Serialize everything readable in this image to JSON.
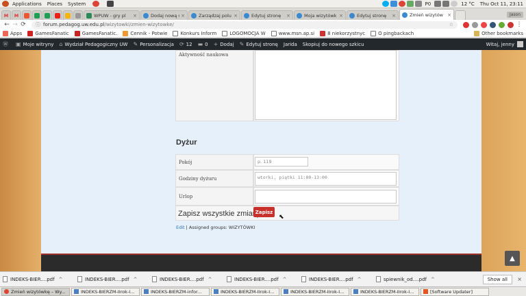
{
  "panel": {
    "applications": "Applications",
    "places": "Places",
    "system": "System",
    "indicator_p0": "P0",
    "weather": "12 °C",
    "clock": "Thu Oct 11, 23:11"
  },
  "tabs": [
    {
      "title": "WPUW - gry pl",
      "color": "#3b8ad0"
    },
    {
      "title": "Dodaj nową st",
      "color": "#3b8ad0"
    },
    {
      "title": "Zarządzaj polu",
      "color": "#3b8ad0"
    },
    {
      "title": "Edytuj stronę",
      "color": "#3b8ad0"
    },
    {
      "title": "Moja wizytówk",
      "color": "#3b8ad0"
    },
    {
      "title": "Edytuj stronę",
      "color": "#3b8ad0"
    },
    {
      "title": "Zmień wizytów",
      "color": "#3b8ad0"
    }
  ],
  "profile_label": "Jason",
  "address": {
    "host": "forum.pedagog.uw.edu.pl",
    "path": "/wizytowki/zmien-wizytowke/"
  },
  "bookmarks": [
    {
      "label": "Apps"
    },
    {
      "label": "GamesFanatic"
    },
    {
      "label": "GamesFanatic."
    },
    {
      "label": "Cennik - Potwie"
    },
    {
      "label": "Konkurs Inform"
    },
    {
      "label": "LOGOMOCJA W"
    },
    {
      "label": "www.msn.ap.si"
    },
    {
      "label": "8 niekorzystnyc"
    },
    {
      "label": "O pingbackach"
    }
  ],
  "other_bookmarks": "Other bookmarks",
  "wpbar": {
    "my_sites": "Moje witryny",
    "site": "Wydział Pedagogiczny UW",
    "customize": "Personalizacja",
    "updates": "12",
    "comments": "0",
    "add": "Dodaj",
    "edit_page": "Edytuj stronę",
    "jarida": "Jarida",
    "copy_draft": "Skopiuj do nowego szkicu",
    "greeting": "Witaj, jenny"
  },
  "form": {
    "research_label": "Aktywność naukowa",
    "section_heading": "Dyżur",
    "room_label": "Pokój",
    "room_placeholder": "p. 119",
    "hours_label": "Godziny dyżuru",
    "hours_placeholder": "wtorki, piątki 11:00-13:00",
    "leave_label": "Urlop",
    "save_all_label": "Zapisz wszystkie zmiany",
    "save_button": "Zapisz",
    "edit_link": "Edit",
    "assigned": "| Assigned groups: WIZYTÓWKI"
  },
  "downloads": [
    {
      "name": "INDEKS-BIER....pdf"
    },
    {
      "name": "INDEKS-BIER....pdf"
    },
    {
      "name": "INDEKS-BIER....pdf"
    },
    {
      "name": "INDEKS-BIER....pdf"
    },
    {
      "name": "INDEKS-BIER....pdf"
    },
    {
      "name": "spiewnik_od....pdf"
    }
  ],
  "show_all": "Show all",
  "taskbar": [
    {
      "title": "Zmień wizytówkę – Wy..."
    },
    {
      "title": "INDEKS-BIERZM-IIrok-I..."
    },
    {
      "title": "INDEKS-BIERZM-infor..."
    },
    {
      "title": "INDEKS-BIERZM-IIrok-I..."
    },
    {
      "title": "INDEKS-BIERZM-IIrok-I..."
    },
    {
      "title": "INDEKS-BIERZM-IIrok-I..."
    },
    {
      "title": "[Software Updater]"
    }
  ]
}
